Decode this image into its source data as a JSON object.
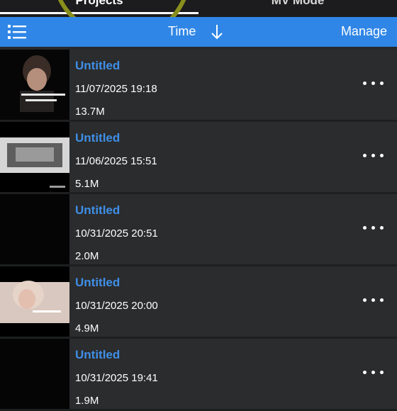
{
  "tabs": [
    {
      "label": "Projects"
    },
    {
      "label": "MV Mode"
    }
  ],
  "toolbar": {
    "menu_icon": "list-icon",
    "sort_label": "Time",
    "sort_icon": "arrow-down-icon",
    "manage_label": "Manage"
  },
  "items": [
    {
      "title": "Untitled",
      "date": "11/07/2025 19:18",
      "size": "13.7M"
    },
    {
      "title": "Untitled",
      "date": "11/06/2025 15:51",
      "size": "5.1M"
    },
    {
      "title": "Untitled",
      "date": "10/31/2025 20:51",
      "size": "2.0M"
    },
    {
      "title": "Untitled",
      "date": "10/31/2025 20:00",
      "size": "4.9M"
    },
    {
      "title": "Untitled",
      "date": "10/31/2025 19:41",
      "size": "1.9M"
    }
  ],
  "colors": {
    "accent": "#2f86e6",
    "title_text": "#3f8fe6",
    "background": "#28292b"
  }
}
